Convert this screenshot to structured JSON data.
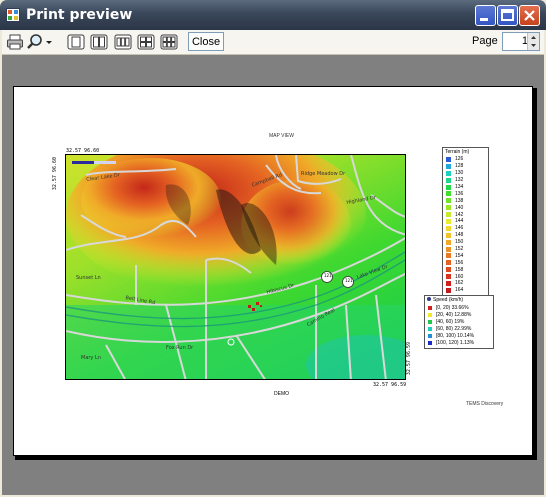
{
  "window": {
    "title": "Print preview",
    "controls": {
      "minimize": "minimize",
      "maximize": "maximize",
      "close": "close"
    }
  },
  "toolbar": {
    "close_label": "Close",
    "page_label": "Page",
    "page_value": "1",
    "icons": [
      "printer-icon",
      "zoom-icon",
      "dropdown-arrow-icon",
      "one-page-icon",
      "two-pages-icon",
      "three-pages-icon",
      "four-pages-icon",
      "six-pages-icon"
    ]
  },
  "preview": {
    "map_title": "MAP VIEW",
    "caption": "DEMO",
    "brand": "TEMS Discovery",
    "coords": {
      "top_left": "32.57 96.60",
      "bottom_right": "32.57 96.59",
      "left_side": "32.57 96.60",
      "right_side": "32.57 96.59"
    },
    "street_labels": [
      "Clear Lake Dr",
      "Ridge Meadow Dr",
      "Campbell Rd",
      "Highland Dr",
      "Belt Line Rd",
      "Hibiscus Dr",
      "Lake View Dr",
      "Sunset Ln",
      "Camino Real",
      "Fox Run Dr",
      "Mary Ln"
    ],
    "route_markers": [
      "121",
      "121"
    ],
    "terrain_legend": {
      "title": "Terrain (m)",
      "items": [
        {
          "label": "126",
          "color": "#2a5bd7"
        },
        {
          "label": "128",
          "color": "#20a8d8"
        },
        {
          "label": "130",
          "color": "#1fd0c0"
        },
        {
          "label": "132",
          "color": "#1ed88a"
        },
        {
          "label": "134",
          "color": "#22d84a"
        },
        {
          "label": "136",
          "color": "#3ee02c"
        },
        {
          "label": "138",
          "color": "#6ee42a"
        },
        {
          "label": "140",
          "color": "#9ee82a"
        },
        {
          "label": "142",
          "color": "#c8ec2c"
        },
        {
          "label": "144",
          "color": "#e8ec2e"
        },
        {
          "label": "146",
          "color": "#f2da2c"
        },
        {
          "label": "148",
          "color": "#f2c22a"
        },
        {
          "label": "150",
          "color": "#f0aa28"
        },
        {
          "label": "152",
          "color": "#ec9226"
        },
        {
          "label": "154",
          "color": "#e87a24"
        },
        {
          "label": "156",
          "color": "#e46222"
        },
        {
          "label": "158",
          "color": "#de4a20"
        },
        {
          "label": "160",
          "color": "#d8341e"
        },
        {
          "label": "162",
          "color": "#d0201c"
        },
        {
          "label": "164",
          "color": "#c41a1a"
        }
      ]
    },
    "speed_legend": {
      "title": "Speed (km/h)",
      "items": [
        {
          "label": "[0, 20) 33.66%",
          "color": "#d4201c"
        },
        {
          "label": "[20, 40) 12.88%",
          "color": "#f2e82c"
        },
        {
          "label": "[40, 60)  19%",
          "color": "#22c84a"
        },
        {
          "label": "[60, 80) 22.99%",
          "color": "#1ed0c0"
        },
        {
          "label": "[80, 100) 10.14%",
          "color": "#2090d8"
        },
        {
          "label": "[100, 120) 1.13%",
          "color": "#1a2cc8"
        }
      ]
    }
  }
}
